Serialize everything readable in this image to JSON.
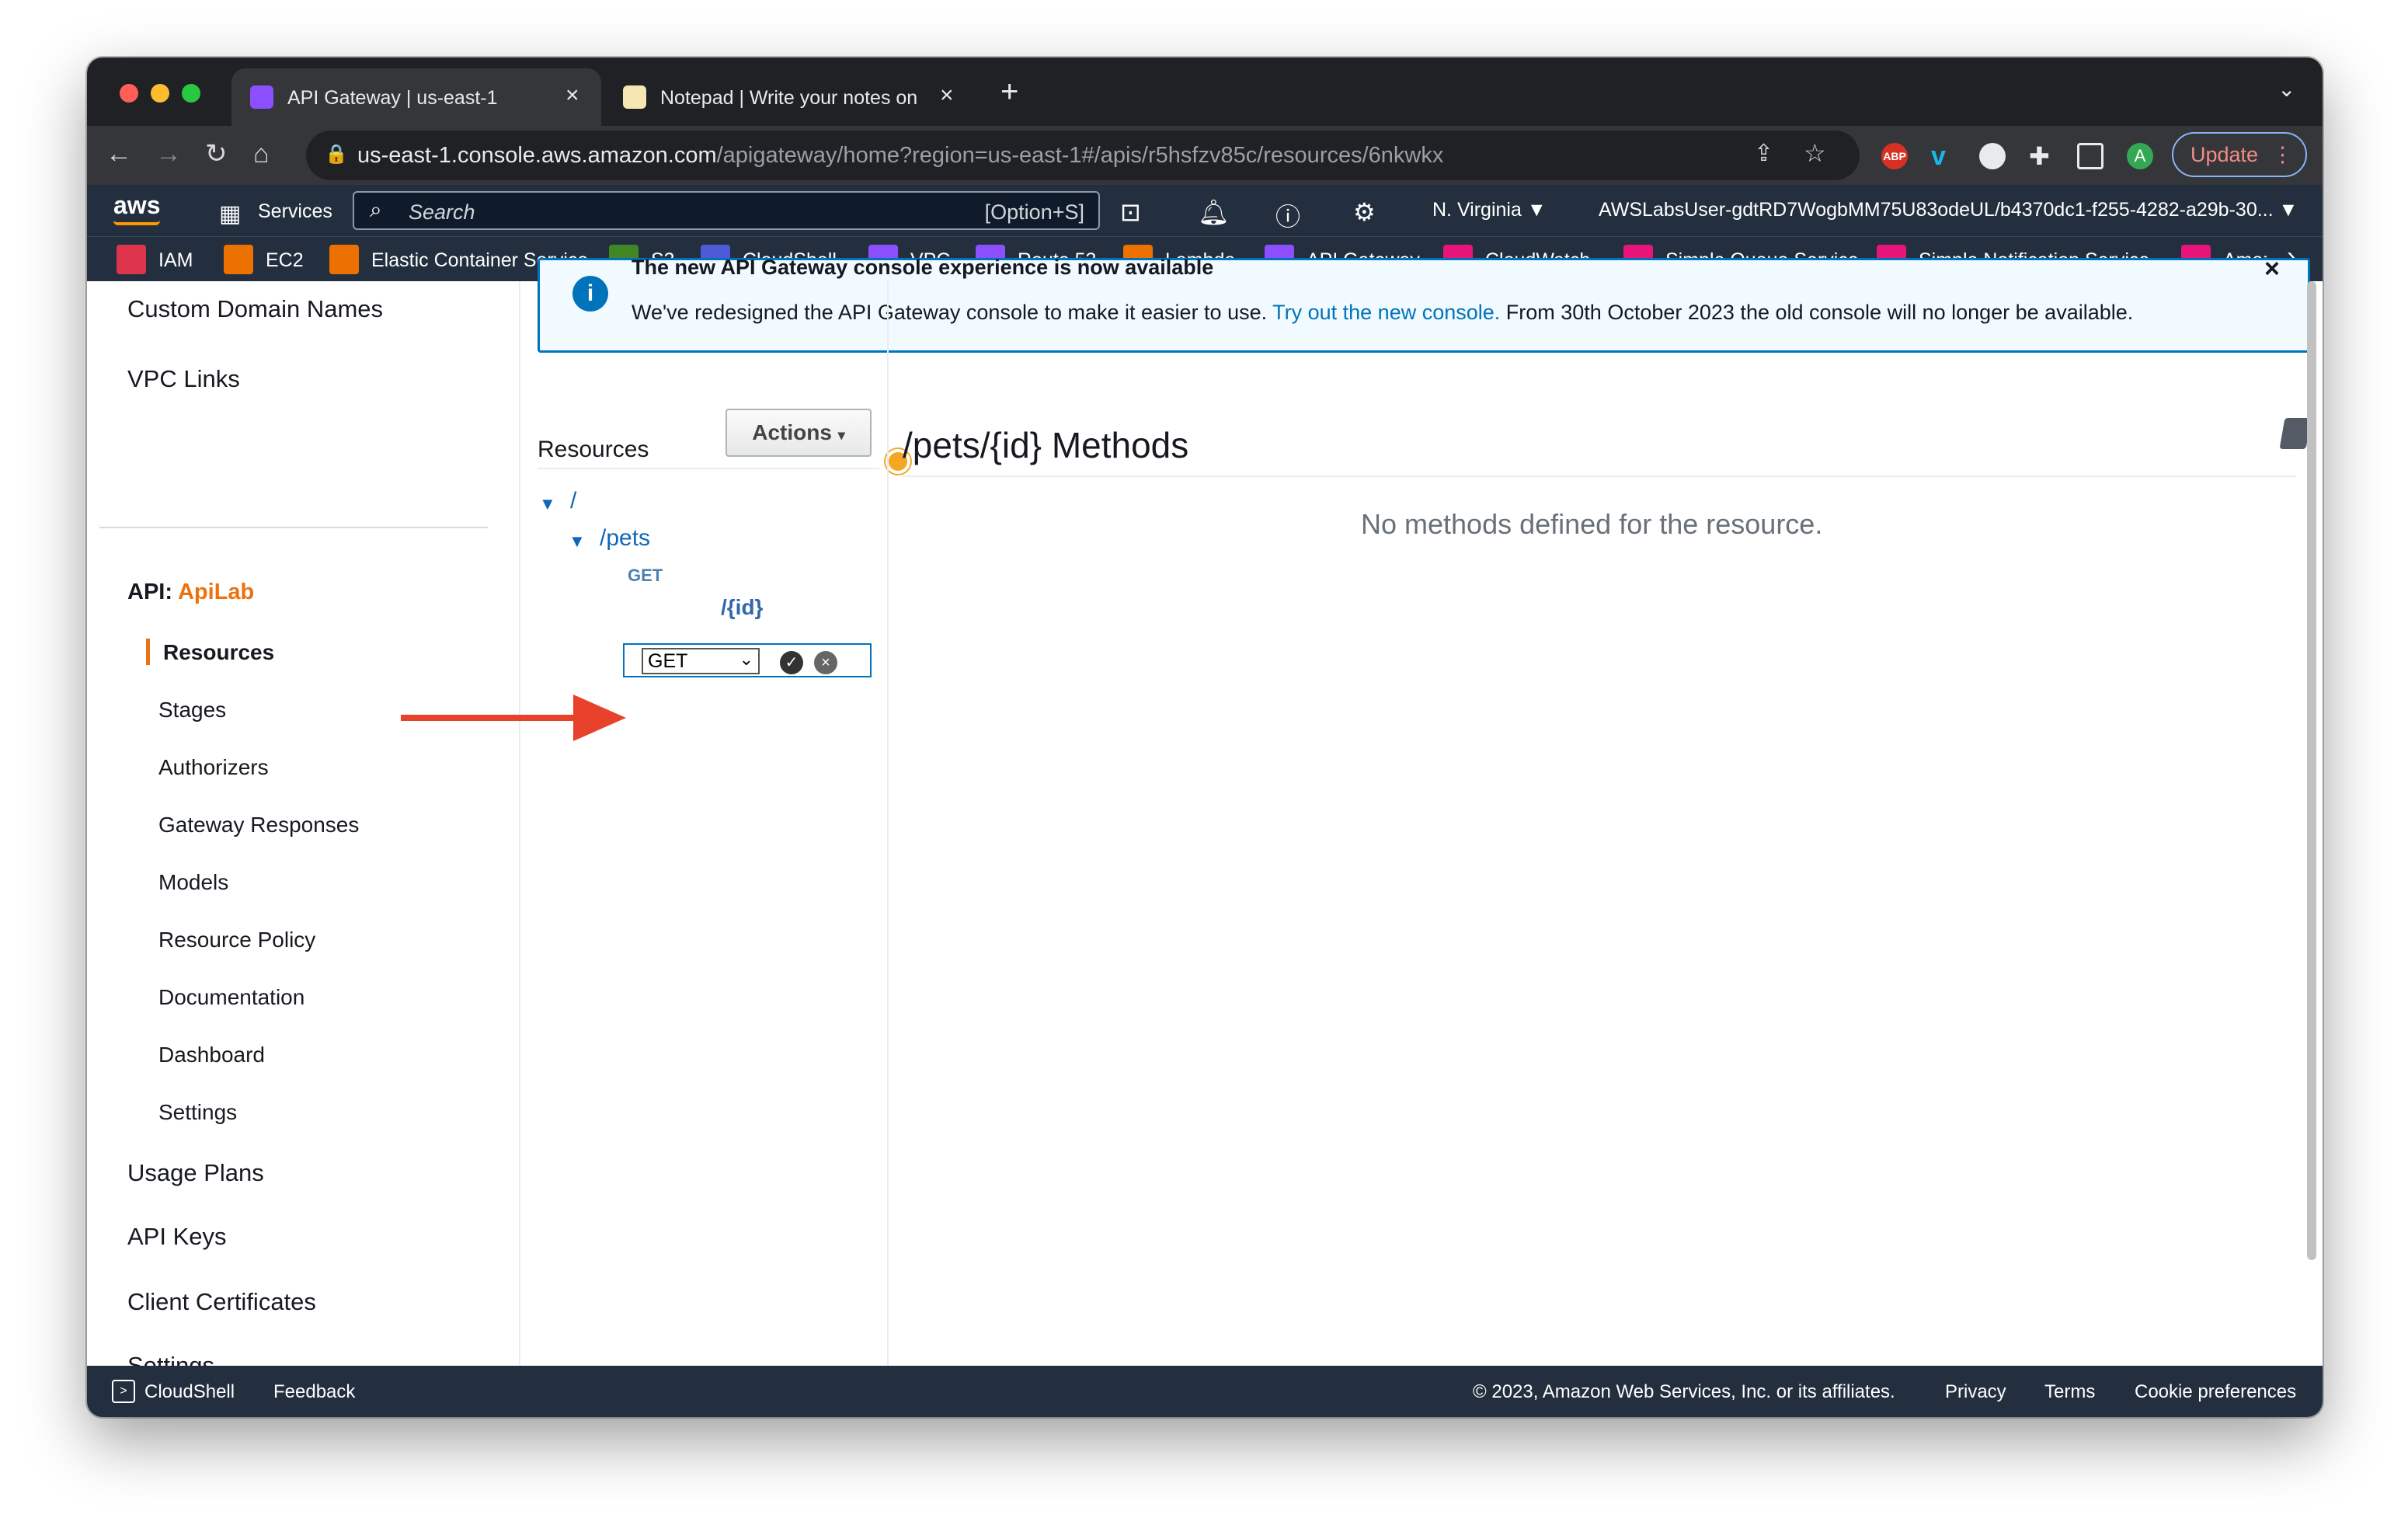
{
  "browser": {
    "tabs": [
      {
        "title": "API Gateway | us-east-1",
        "close": "×"
      },
      {
        "title": "Notepad | Write your notes on",
        "close": "×"
      }
    ],
    "new_tab": "+",
    "url_host": "us-east-1.console.aws.amazon.com",
    "url_path": "/apigateway/home?region=us-east-1#/apis/r5hsfzv85c/resources/6nkwkx",
    "profile_initial": "A",
    "update_label": "Update",
    "extensions": [
      "ABP"
    ]
  },
  "aws_nav": {
    "logo": "aws",
    "services_label": "Services",
    "search_placeholder": "Search",
    "search_shortcut": "[Option+S]",
    "region": "N. Virginia ▼",
    "account": "AWSLabsUser-gdtRD7WogbMM75U83odeUL/b4370dc1-f255-4282-a29b-30... ▼"
  },
  "favorites": [
    {
      "label": "IAM",
      "color": "#dd344c"
    },
    {
      "label": "EC2",
      "color": "#ed7100"
    },
    {
      "label": "Elastic Container Service",
      "color": "#ed7100"
    },
    {
      "label": "S3",
      "color": "#3f8624"
    },
    {
      "label": "CloudShell",
      "color": "#4d5bd9"
    },
    {
      "label": "VPC",
      "color": "#8c4fff"
    },
    {
      "label": "Route 53",
      "color": "#8c4fff"
    },
    {
      "label": "Lambda",
      "color": "#ed7100"
    },
    {
      "label": "API Gateway",
      "color": "#8c4fff"
    },
    {
      "label": "CloudWatch",
      "color": "#e7157b"
    },
    {
      "label": "Simple Queue Service",
      "color": "#e7157b"
    },
    {
      "label": "Simple Notification Service",
      "color": "#e7157b"
    },
    {
      "label": "Amazo",
      "color": "#e7157b"
    }
  ],
  "banner": {
    "heading": "The new API Gateway console experience is now available",
    "text_before": "We've redesigned the API Gateway console to make it easier to use. ",
    "link": "Try out the new console.",
    "text_after": " From 30th October 2023 the old console will no longer be available."
  },
  "sidebar": {
    "top_items": [
      "Custom Domain Names",
      "VPC Links"
    ],
    "api_prefix": "API:",
    "api_name": "ApiLab",
    "sub_items": [
      "Resources",
      "Stages",
      "Authorizers",
      "Gateway Responses",
      "Models",
      "Resource Policy",
      "Documentation",
      "Dashboard",
      "Settings"
    ],
    "bottom_items": [
      "Usage Plans",
      "API Keys",
      "Client Certificates",
      "Settings"
    ]
  },
  "resources_panel": {
    "label": "Resources",
    "actions_label": "Actions",
    "tree": {
      "root": "/",
      "pets": "/pets",
      "pets_method": "GET",
      "id": "/{id}",
      "new_method_value": "GET"
    }
  },
  "main": {
    "title": "/pets/{id} Methods",
    "empty_message": "No methods defined for the resource."
  },
  "footer": {
    "cloudshell": "CloudShell",
    "feedback": "Feedback",
    "copyright": "© 2023, Amazon Web Services, Inc. or its affiliates.",
    "privacy": "Privacy",
    "terms": "Terms",
    "cookies": "Cookie preferences"
  }
}
